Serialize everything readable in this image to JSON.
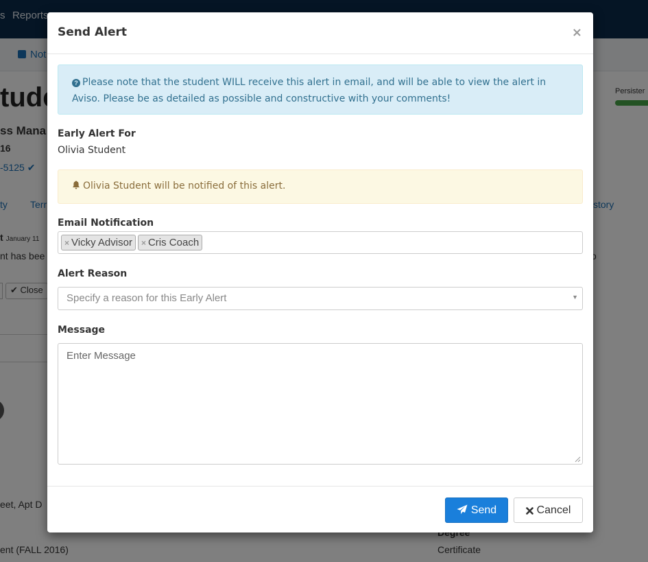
{
  "background": {
    "nav": [
      "s",
      "Reports"
    ],
    "subbar_link": "Not",
    "student_title": "tude",
    "subtitle": "ss Mana",
    "year": "16",
    "phone": "-5125 ✔",
    "tabs": [
      "ty",
      "Terr",
      "story"
    ],
    "alert_title": "t",
    "alert_date": "January 11",
    "alert_text": "nt has bee",
    "alert_tail": "o",
    "close_label": "✔ Close",
    "address": "eet, Apt D",
    "enrollment": "ent (FALL 2016)",
    "degree_label": "Degree",
    "degree_value": "Certificate",
    "persistence_label": "Persister"
  },
  "modal": {
    "title": "Send Alert",
    "close_glyph": "×",
    "info_message": "Please note that the student WILL receive this alert in email, and will be able to view the alert in Aviso. Please be as detailed as possible and constructive with your comments!",
    "early_alert_for_label": "Early Alert For",
    "student_name": "Olivia Student",
    "notify_message": "Olivia Student will be notified of this alert.",
    "email_notification_label": "Email Notification",
    "recipients": [
      "Vicky Advisor",
      "Cris Coach"
    ],
    "tag_remove_glyph": "×",
    "alert_reason_label": "Alert Reason",
    "alert_reason_placeholder": "Specify a reason for this Early Alert",
    "message_label": "Message",
    "message_placeholder": "Enter Message",
    "send_label": "Send",
    "cancel_label": "Cancel"
  },
  "colors": {
    "primary": "#1a7fdb",
    "info_bg": "#d9edf7",
    "warning_bg": "#fcf8e3",
    "navbar": "#0b2a4a"
  }
}
